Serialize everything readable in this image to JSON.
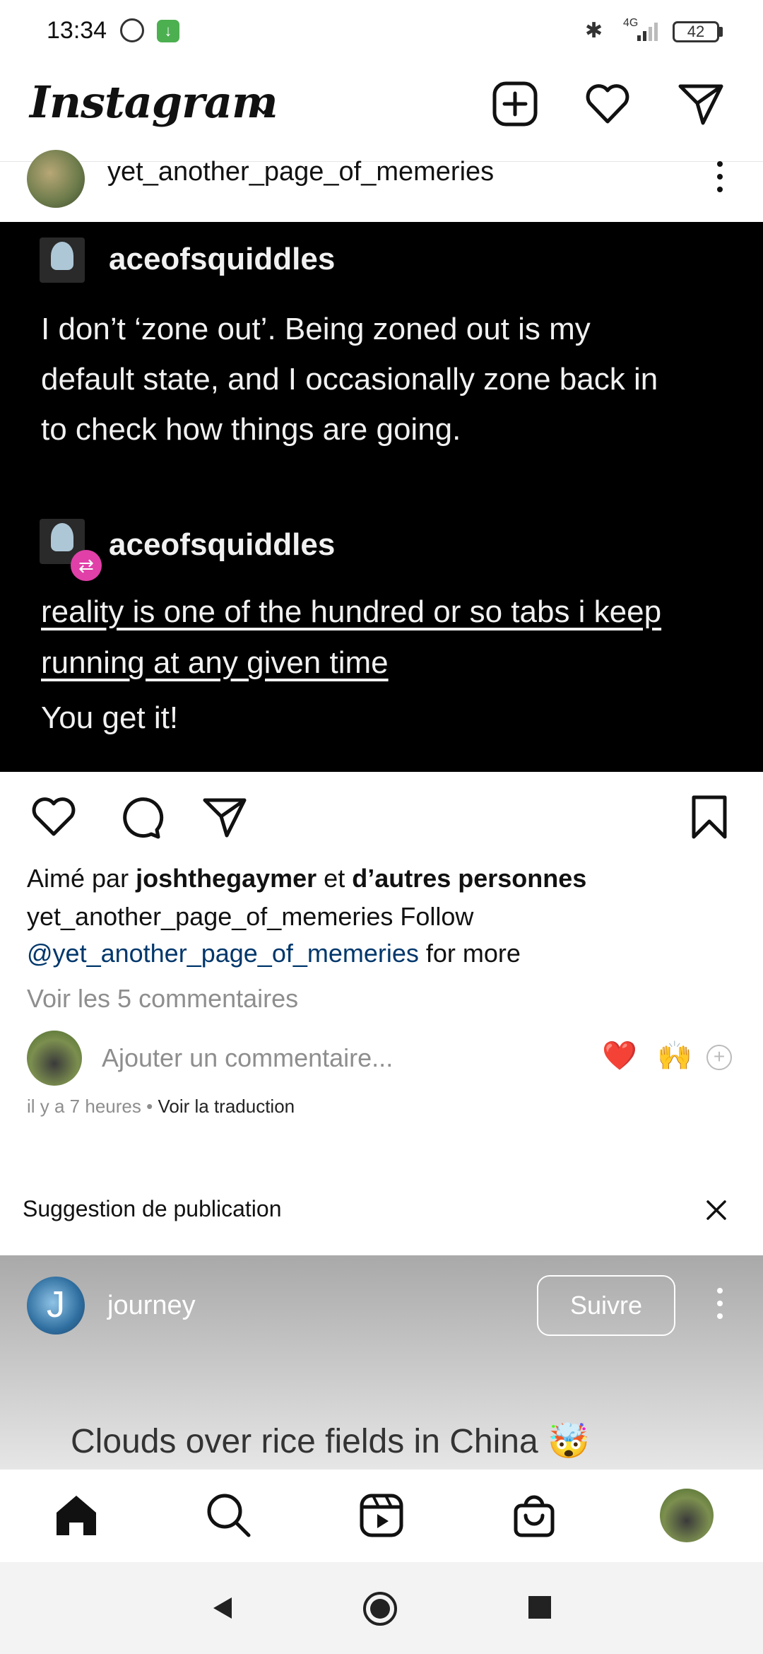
{
  "status_bar": {
    "time": "13:34",
    "network": "4G",
    "battery": "42"
  },
  "header": {
    "logo": "Instagram"
  },
  "post": {
    "username": "yet_another_page_of_memeries",
    "image": {
      "author1": "aceofsquiddles",
      "text1_line1": "I don’t ‘zone out’. Being zoned out is my",
      "text1_line2": "default state, and I occasionally zone back in",
      "text1_line3": "to check how things are going.",
      "author2": "aceofsquiddles",
      "text2_line1": "reality is one of the hundred or so tabs i keep",
      "text2_line2": "running at any given time",
      "text3": "You get it!"
    },
    "likes_prefix": "Aimé par",
    "likes_user": "joshthegaymer",
    "likes_mid": "et",
    "likes_suffix": "d’autres personnes",
    "caption_user": "yet_another_page_of_memeries",
    "caption_text": "Follow",
    "caption_mention": "@yet_another_page_of_memeries",
    "caption_end": "for more",
    "view_comments": "Voir les 5 commentaires",
    "add_comment_placeholder": "Ajouter un commentaire...",
    "emoji1": "❤️",
    "emoji2": "🙌",
    "time_ago": "il y a 7 heures",
    "separator": "•",
    "translate": "Voir la traduction"
  },
  "suggestion": {
    "title": "Suggestion de publication",
    "avatar_letter": "J",
    "username": "journey",
    "follow_label": "Suivre",
    "caption": "Clouds over rice fields in China 🤯"
  }
}
